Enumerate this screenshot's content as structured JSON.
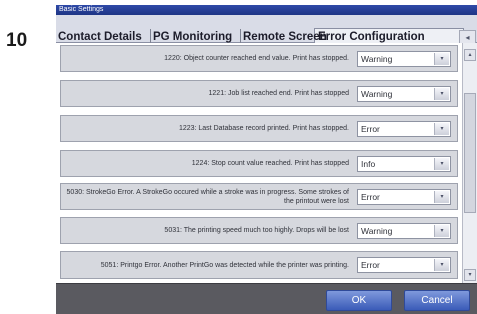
{
  "step_number": "10",
  "window": {
    "title": "Basic Settings"
  },
  "tabs": [
    {
      "label": "Contact Details",
      "active": false
    },
    {
      "label": "PG Monitoring",
      "active": false
    },
    {
      "label": "Remote Screen",
      "active": false
    },
    {
      "label": "Error Configuration",
      "active": true
    }
  ],
  "tab_scroll": {
    "icon": "chevron-left-icon",
    "glyph": "◂"
  },
  "errors": [
    {
      "message": "1220: Object counter reached end value. Print has stopped.",
      "level": "Warning"
    },
    {
      "message": "1221: Job list reached end. Print has stopped",
      "level": "Warning"
    },
    {
      "message": "1223: Last Database record printed. Print has stopped.",
      "level": "Error"
    },
    {
      "message": "1224: Stop count value reached. Print has stopped",
      "level": "Info"
    },
    {
      "message": "5030: StrokeGo Error. A StrokeGo occured while a stroke was in progress. Some strokes of the printout were lost",
      "level": "Error"
    },
    {
      "message": "5031: The printing speed much too highly. Drops will be lost",
      "level": "Warning"
    },
    {
      "message": "5051: Printgo Error. Another PrintGo was detected while the printer was printing.",
      "level": "Error"
    }
  ],
  "select_arrow_glyph": "▾",
  "scrollbar": {
    "up_glyph": "▴",
    "down_glyph": "▾"
  },
  "footer": {
    "ok_label": "OK",
    "cancel_label": "Cancel"
  },
  "colors": {
    "titlebar": "#1e3585",
    "button": "#3a5bb8",
    "footer": "#5a5a60",
    "row_background": "#d6d8de"
  }
}
